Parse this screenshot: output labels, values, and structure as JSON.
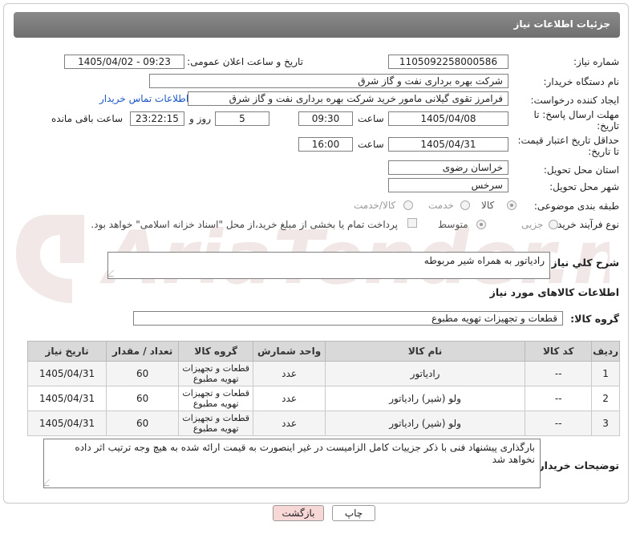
{
  "header": {
    "title": "جزئیات اطلاعات نیاز"
  },
  "form": {
    "need_number": {
      "label": "شماره نیاز:",
      "value": "1105092258000586"
    },
    "announce": {
      "label": "تاریخ و ساعت اعلان عمومی:",
      "value": "1405/04/02 - 09:23"
    },
    "buyer": {
      "label": "نام دستگاه خریدار:",
      "value": "شرکت بهره برداری نفت و گاز شرق"
    },
    "requester": {
      "label": "ایجاد کننده درخواست:",
      "value": "فرامرز تقوی گیلانی مامور خرید شرکت بهره برداری نفت و گاز شرق",
      "contact_link": "اطلاعات تماس خریدار"
    },
    "reply_deadline": {
      "label_line1": "مهلت ارسال پاسخ: تا",
      "label_line2": "تاریخ:",
      "date": "1405/04/08",
      "time_label": "ساعت",
      "time": "09:30",
      "days": "5",
      "days_label": "روز و",
      "remaining": "23:22:15",
      "remaining_label": "ساعت باقی مانده"
    },
    "price_validity": {
      "label_line1": "حداقل تاریخ اعتبار قیمت:",
      "label_line2": "تا تاریخ:",
      "date": "1405/04/31",
      "time_label": "ساعت",
      "time": "16:00"
    },
    "province": {
      "label": "استان محل تحویل:",
      "value": "خراسان رضوی"
    },
    "city": {
      "label": "شهر محل تحویل:",
      "value": "سرخس"
    },
    "category": {
      "label": "طبقه بندی موضوعی:",
      "options": [
        "کالا",
        "خدمت",
        "کالا/خدمت"
      ],
      "selected": "کالا"
    },
    "process": {
      "label": "نوع فرآیند خرید :",
      "options": [
        "جزیی",
        "متوسط"
      ],
      "selected": "متوسط",
      "payment_note": "پرداخت تمام یا بخشی از مبلغ خرید،از محل \"اسناد خزانه اسلامی\" خواهد بود."
    }
  },
  "description": {
    "label": "شرح کلي نياز:",
    "value": "رادیاتور به همراه شیر مربوطه"
  },
  "goods_info": {
    "title": "اطلاعات کالاهای مورد نیاز"
  },
  "goods_group": {
    "label": "گروه کالا:",
    "value": "قطعات و تجهیزات تهویه مطبوع"
  },
  "table": {
    "headers": [
      "ردیف",
      "کد کالا",
      "نام کالا",
      "واحد شمارش",
      "گروه کالا",
      "تعداد / مقدار",
      "تاریخ نیاز"
    ],
    "rows": [
      {
        "row": "1",
        "code": "--",
        "name": "رادیاتور",
        "unit": "عدد",
        "group_l1": "قطعات و تجهیزات",
        "group_l2": "تهویه مطبوع",
        "qty": "60",
        "date": "1405/04/31"
      },
      {
        "row": "2",
        "code": "--",
        "name": "ولو (شیر) رادیاتور",
        "unit": "عدد",
        "group_l1": "قطعات و تجهیزات",
        "group_l2": "تهویه مطبوع",
        "qty": "60",
        "date": "1405/04/31"
      },
      {
        "row": "3",
        "code": "--",
        "name": "ولو (شیر) رادیاتور",
        "unit": "عدد",
        "group_l1": "قطعات و تجهیزات",
        "group_l2": "تهویه مطبوع",
        "qty": "60",
        "date": "1405/04/31"
      }
    ]
  },
  "buyer_notes": {
    "label": "توضیحات خریدار:",
    "value": "بارگذاری پیشنهاد فنی با ذکر جزییات کامل الزامیست در غیر اینصورت به قیمت ارائه شده به هیچ وجه ترتیب اثر داده نخواهد شد"
  },
  "buttons": {
    "print": "چاپ",
    "back": "بازگشت"
  },
  "watermark": {
    "text": "AriaTender.net"
  },
  "colors": {
    "header_bg": "#7c7c7c",
    "link": "#1a56c8",
    "back_button_bg": "#f8d7d7",
    "print_button_bg": "#ffffff"
  }
}
